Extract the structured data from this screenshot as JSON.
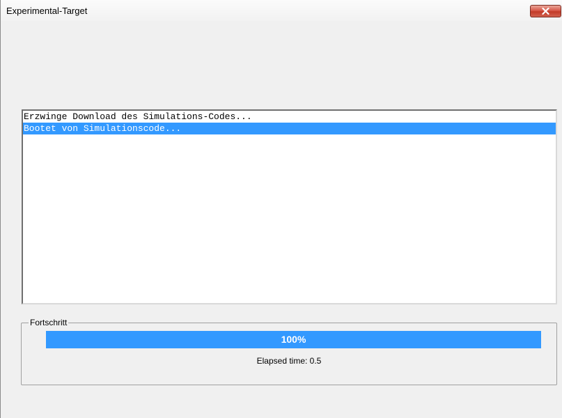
{
  "window": {
    "title": "Experimental-Target"
  },
  "titlebar": {
    "close_icon": "close-icon"
  },
  "log": {
    "items": [
      {
        "text": "Erzwinge Download des Simulations-Codes...",
        "selected": false
      },
      {
        "text": "Bootet von Simulationscode...",
        "selected": true
      }
    ]
  },
  "progress_group": {
    "label": "Fortschritt",
    "progress_text": "100%",
    "progress_value": 1.0,
    "elapsed_text": "Elapsed time: 0.5"
  },
  "colors": {
    "accent": "#3399ff",
    "window_bg": "#f0f0f0",
    "close_button": "#c23a28"
  }
}
